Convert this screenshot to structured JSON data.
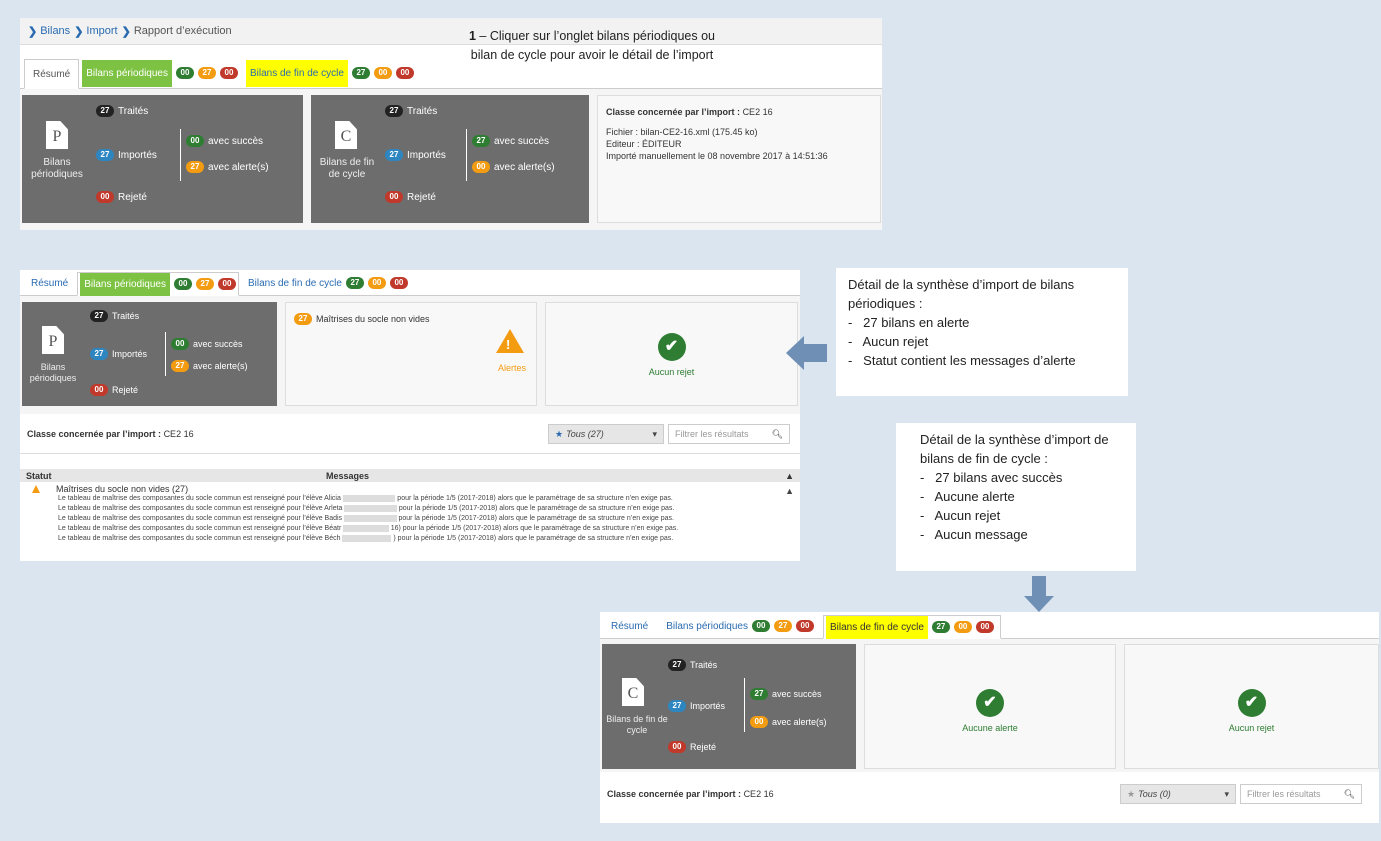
{
  "panel1": {
    "breadcrumb": [
      "Bilans",
      "Import",
      "Rapport d’exécution"
    ],
    "tabs": {
      "resume": "Résumé",
      "periodiques": "Bilans périodiques",
      "periodiques_badges": [
        "00",
        "27",
        "00"
      ],
      "fin_cycle": "Bilans de fin de cycle",
      "fin_cycle_badges": [
        "27",
        "00",
        "00"
      ]
    },
    "box_p": {
      "letter": "P",
      "label": "Bilans périodiques",
      "traites_n": "27",
      "traites": "Traités",
      "importes_n": "27",
      "importes": "Importés",
      "rejete_n": "00",
      "rejete": "Rejeté",
      "succes_n": "00",
      "succes": "avec succès",
      "alerte_n": "27",
      "alerte": "avec alerte(s)"
    },
    "box_c": {
      "letter": "C",
      "label": "Bilans de fin de cycle",
      "traites_n": "27",
      "traites": "Traités",
      "importes_n": "27",
      "importes": "Importés",
      "rejete_n": "00",
      "rejete": "Rejeté",
      "succes_n": "27",
      "succes": "avec succès",
      "alerte_n": "00",
      "alerte": "avec alerte(s)"
    },
    "info": {
      "classe_lbl": "Classe concernée par l’import :",
      "classe": "CE2 16",
      "fichier": "Fichier : bilan-CE2-16.xml (175.45 ko)",
      "editeur": "Editeur : ÉDITEUR",
      "importe": "Importé manuellement le 08 novembre 2017 à 14:51:36"
    }
  },
  "note1": {
    "num": "1",
    "text1": " – Cliquer sur l’onglet bilans périodiques ou",
    "text2": "bilan de cycle  pour avoir le détail de l’import"
  },
  "panel2": {
    "tabs": {
      "resume": "Résumé",
      "periodiques": "Bilans périodiques",
      "periodiques_badges": [
        "00",
        "27",
        "00"
      ],
      "fin_cycle": "Bilans de fin de cycle",
      "fin_cycle_badges": [
        "27",
        "00",
        "00"
      ]
    },
    "box_p": {
      "letter": "P",
      "label": "Bilans périodiques",
      "traites_n": "27",
      "traites": "Traités",
      "importes_n": "27",
      "importes": "Importés",
      "rejete_n": "00",
      "rejete": "Rejeté",
      "succes_n": "00",
      "succes": "avec succès",
      "alerte_n": "27",
      "alerte": "avec alerte(s)"
    },
    "maitrises_n": "27",
    "maitrises": "Maîtrises du socle non vides",
    "alertes": "Alertes",
    "aucun_rejet": "Aucun rejet",
    "classe_lbl": "Classe concernée par l’import :",
    "classe": "CE2 16",
    "filter_select": "Tous (27)",
    "filter_placeholder": "Filtrer les résultats",
    "col_statut": "Statut",
    "col_messages": "Messages",
    "group_title": "Maîtrises du socle non vides (27)",
    "messages": [
      "Le tableau de maîtrise des composantes du socle commun est renseigné pour l’élève Alicia",
      "Le tableau de maîtrise des composantes du socle commun est renseigné pour l’élève Arleta",
      "Le tableau de maîtrise des composantes du socle commun est renseigné pour l’élève Badis",
      "Le tableau de maîtrise des composantes du socle commun est renseigné pour l’élève Béatr",
      "Le tableau de maîtrise des composantes du socle commun est renseigné pour l’élève Béch"
    ],
    "messages_suffix": [
      "pour la période 1/5 (2017-2018) alors que le paramétrage de sa structure n’en exige pas.",
      "pour la période 1/5 (2017-2018) alors que le paramétrage de sa structure n’en exige pas.",
      "pour la période 1/5 (2017-2018) alors que le paramétrage de sa structure n’en exige pas.",
      "16) pour la période 1/5 (2017-2018) alors que le paramétrage de sa structure n’en exige pas.",
      ") pour la période 1/5 (2017-2018) alors que le paramétrage de sa structure n’en exige pas."
    ]
  },
  "note2": {
    "title": "Détail de la synthèse d’import de bilans périodiques :",
    "items": [
      "27 bilans en alerte",
      "Aucun rejet",
      "Statut contient les messages d’alerte"
    ]
  },
  "note3": {
    "title": "Détail de la synthèse d’import de bilans de fin de cycle :",
    "items": [
      "27 bilans avec succès",
      "Aucune alerte",
      "Aucun rejet",
      "Aucun message"
    ]
  },
  "panel3": {
    "tabs": {
      "resume": "Résumé",
      "periodiques": "Bilans périodiques",
      "periodiques_badges": [
        "00",
        "27",
        "00"
      ],
      "fin_cycle": "Bilans de fin de cycle",
      "fin_cycle_badges": [
        "27",
        "00",
        "00"
      ]
    },
    "box_c": {
      "letter": "C",
      "label": "Bilans de fin de cycle",
      "traites_n": "27",
      "traites": "Traités",
      "importes_n": "27",
      "importes": "Importés",
      "rejete_n": "00",
      "rejete": "Rejeté",
      "succes_n": "27",
      "succes": "avec succès",
      "alerte_n": "00",
      "alerte": "avec alerte(s)"
    },
    "aucune_alerte": "Aucune alerte",
    "aucun_rejet": "Aucun rejet",
    "classe_lbl": "Classe concernée par l’import :",
    "classe": "CE2 16",
    "filter_select": "Tous (0)",
    "filter_placeholder": "Filtrer les résultats"
  },
  "colors": {
    "green_tab": "#7dc242",
    "yellow_tab": "#ffff00",
    "stat_bg": "#6d6d6d",
    "arrow": "#6f8fb5"
  }
}
